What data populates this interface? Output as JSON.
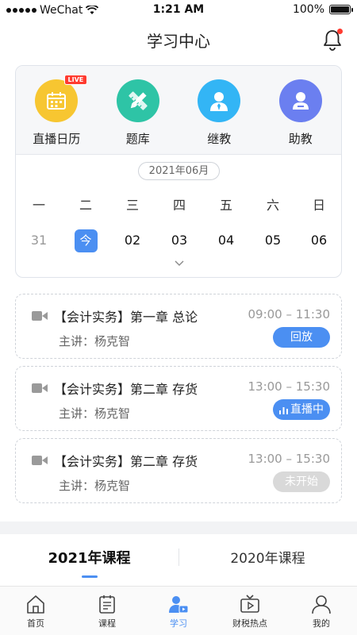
{
  "status_bar": {
    "carrier": "WeChat",
    "time": "1:21 AM",
    "battery": "100%"
  },
  "nav": {
    "title": "学习中心"
  },
  "quick_actions": [
    {
      "label": "直播日历",
      "icon": "calendar-icon",
      "badge": "LIVE",
      "color": "#f7c631"
    },
    {
      "label": "题库",
      "icon": "pencil-ruler-icon",
      "color": "#2ec4a6"
    },
    {
      "label": "继教",
      "icon": "teacher-icon",
      "color": "#33b5f5"
    },
    {
      "label": "助教",
      "icon": "assistant-icon",
      "color": "#6b7ff0"
    }
  ],
  "calendar": {
    "month": "2021年06月",
    "weekdays": [
      "一",
      "二",
      "三",
      "四",
      "五",
      "六",
      "日"
    ],
    "dates": [
      "31",
      "今",
      "02",
      "03",
      "04",
      "05",
      "06"
    ]
  },
  "lessons": [
    {
      "title": "【会计实务】第一章 总论",
      "time": "09:00 – 11:30",
      "teacher": "主讲：杨克智",
      "status": "回放"
    },
    {
      "title": "【会计实务】第二章 存货",
      "time": "13:00 – 15:30",
      "teacher": "主讲：杨克智",
      "status": "直播中"
    },
    {
      "title": "【会计实务】第二章 存货",
      "time": "13:00 – 15:30",
      "teacher": "主讲：杨克智",
      "status": "未开始"
    }
  ],
  "course_tabs": [
    "2021年课程",
    "2020年课程"
  ],
  "tabbar": [
    {
      "label": "首页",
      "icon": "home-icon"
    },
    {
      "label": "课程",
      "icon": "course-icon"
    },
    {
      "label": "学习",
      "icon": "study-icon"
    },
    {
      "label": "财税热点",
      "icon": "tv-icon"
    },
    {
      "label": "我的",
      "icon": "profile-icon"
    }
  ],
  "colors": {
    "accent": "#4b8ff2",
    "live_red": "#ff3b30",
    "disabled": "#d9d9d9"
  }
}
